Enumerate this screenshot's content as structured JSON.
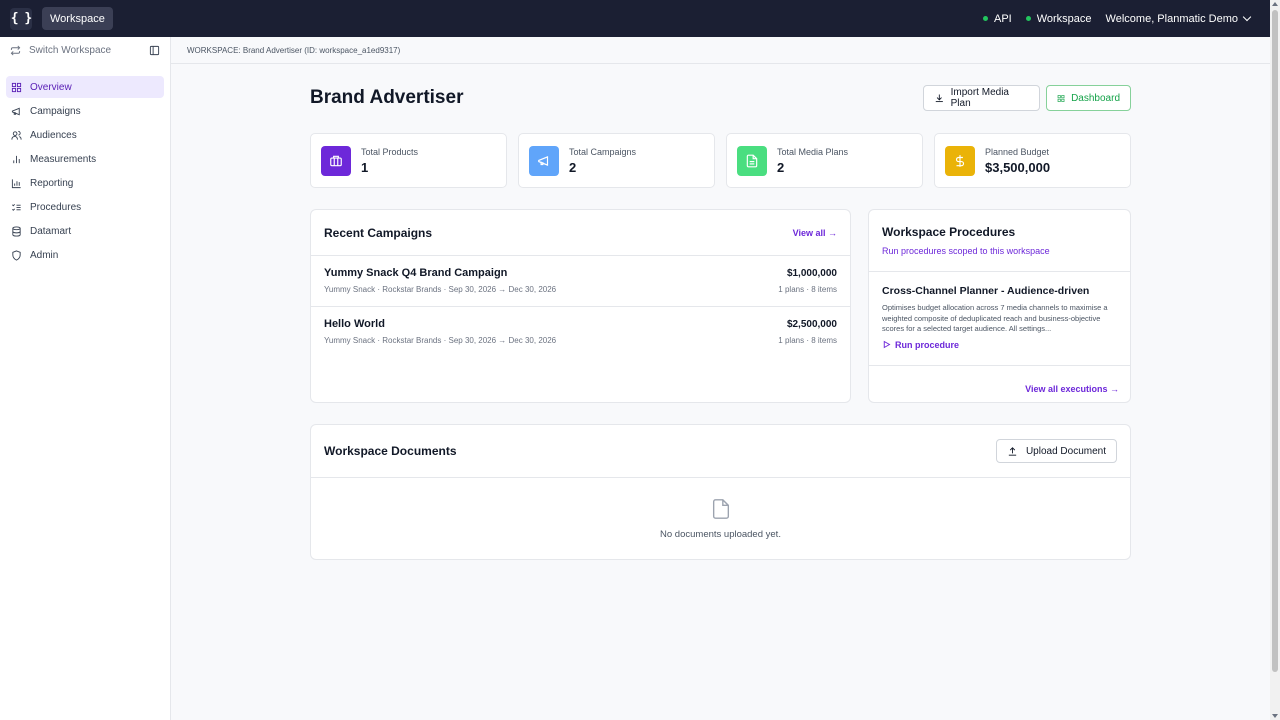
{
  "topbar": {
    "logo_text": "{ }",
    "workspace_pill": "Workspace",
    "status_api": "API",
    "status_workspace": "Workspace",
    "user_greeting": "Welcome, Planmatic Demo",
    "status_color": "#22c55e"
  },
  "sidebar": {
    "switch_label": "Switch Workspace",
    "items": [
      {
        "label": "Overview",
        "icon": "grid-icon",
        "active": true
      },
      {
        "label": "Campaigns",
        "icon": "megaphone-icon"
      },
      {
        "label": "Audiences",
        "icon": "users-icon"
      },
      {
        "label": "Measurements",
        "icon": "bar-chart-icon"
      },
      {
        "label": "Reporting",
        "icon": "chart-icon"
      },
      {
        "label": "Procedures",
        "icon": "list-checks-icon"
      },
      {
        "label": "Datamart",
        "icon": "database-icon"
      },
      {
        "label": "Admin",
        "icon": "shield-icon"
      }
    ]
  },
  "breadcrumb": "WORKSPACE: Brand Advertiser (ID: workspace_a1ed9317)",
  "page": {
    "title": "Brand Advertiser",
    "import_button": "Import Media Plan",
    "dashboard_button": "Dashboard"
  },
  "stats": [
    {
      "label": "Total Products",
      "value": "1",
      "color": "#6d28d9",
      "icon": "briefcase-icon"
    },
    {
      "label": "Total Campaigns",
      "value": "2",
      "color": "#60a5fa",
      "icon": "megaphone-icon"
    },
    {
      "label": "Total Media Plans",
      "value": "2",
      "color": "#4ade80",
      "icon": "document-icon"
    },
    {
      "label": "Planned Budget",
      "value": "$3,500,000",
      "color": "#eab308",
      "icon": "dollar-icon"
    }
  ],
  "recent_campaigns": {
    "title": "Recent Campaigns",
    "view_all": "View all →",
    "rows": [
      {
        "name": "Yummy Snack Q4 Brand Campaign",
        "meta": "Yummy Snack · Rockstar Brands · Sep 30, 2026 → Dec 30, 2026",
        "amount": "$1,000,000",
        "counts": "1 plans · 8 items"
      },
      {
        "name": "Hello World",
        "meta": "Yummy Snack · Rockstar Brands · Sep 30, 2026 → Dec 30, 2026",
        "amount": "$2,500,000",
        "counts": "1 plans · 8 items"
      }
    ]
  },
  "procedures": {
    "title": "Workspace Procedures",
    "subtitle": "Run procedures scoped to this workspace",
    "name": "Cross-Channel Planner - Audience-driven",
    "description": "Optimises budget allocation across 7 media channels to maximise a weighted composite of deduplicated reach and business-objective scores for a selected target audience. All settings...",
    "run_label": "Run procedure",
    "view_all": "View all executions →"
  },
  "documents": {
    "title": "Workspace Documents",
    "upload_button": "Upload Document",
    "empty_text": "No documents uploaded yet."
  }
}
